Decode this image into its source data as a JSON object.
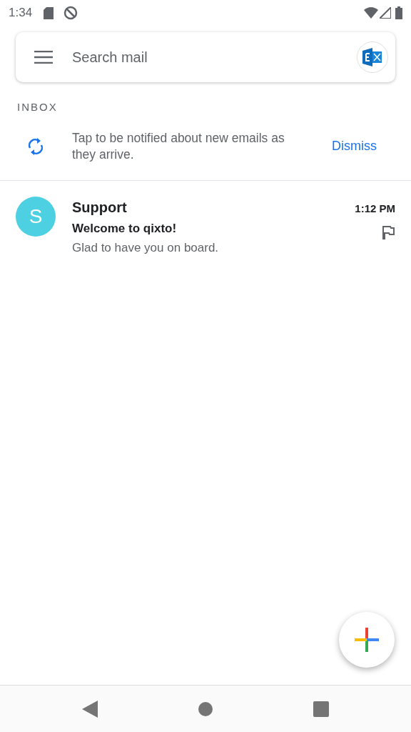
{
  "status_bar": {
    "time": "1:34"
  },
  "search": {
    "placeholder": "Search mail"
  },
  "section_title": "INBOX",
  "notice": {
    "text": "Tap to be notified about new emails as they arrive.",
    "action": "Dismiss"
  },
  "emails": [
    {
      "avatar_letter": "S",
      "color": "#4dd0e1",
      "sender": "Support",
      "time": "1:12 PM",
      "subject": "Welcome to qixto!",
      "preview": "Glad to have you on board.",
      "unread": true
    }
  ]
}
